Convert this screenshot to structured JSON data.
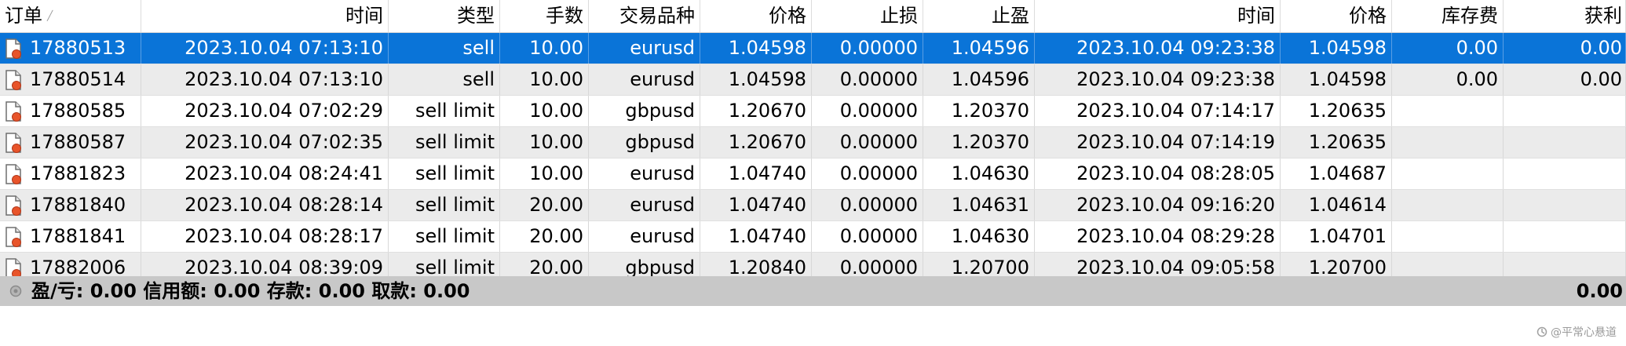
{
  "columns": [
    "订单",
    "时间",
    "类型",
    "手数",
    "交易品种",
    "价格",
    "止损",
    "止盈",
    "时间",
    "价格",
    "库存费",
    "获利"
  ],
  "rows": [
    [
      "17880513",
      "2023.10.04 07:13:10",
      "sell",
      "10.00",
      "eurusd",
      "1.04598",
      "0.00000",
      "1.04596",
      "2023.10.04 09:23:38",
      "1.04598",
      "0.00",
      "0.00"
    ],
    [
      "17880514",
      "2023.10.04 07:13:10",
      "sell",
      "10.00",
      "eurusd",
      "1.04598",
      "0.00000",
      "1.04596",
      "2023.10.04 09:23:38",
      "1.04598",
      "0.00",
      "0.00"
    ],
    [
      "17880585",
      "2023.10.04 07:02:29",
      "sell limit",
      "10.00",
      "gbpusd",
      "1.20670",
      "0.00000",
      "1.20370",
      "2023.10.04 07:14:17",
      "1.20635",
      "",
      ""
    ],
    [
      "17880587",
      "2023.10.04 07:02:35",
      "sell limit",
      "10.00",
      "gbpusd",
      "1.20670",
      "0.00000",
      "1.20370",
      "2023.10.04 07:14:19",
      "1.20635",
      "",
      ""
    ],
    [
      "17881823",
      "2023.10.04 08:24:41",
      "sell limit",
      "10.00",
      "eurusd",
      "1.04740",
      "0.00000",
      "1.04630",
      "2023.10.04 08:28:05",
      "1.04687",
      "",
      ""
    ],
    [
      "17881840",
      "2023.10.04 08:28:14",
      "sell limit",
      "20.00",
      "eurusd",
      "1.04740",
      "0.00000",
      "1.04631",
      "2023.10.04 09:16:20",
      "1.04614",
      "",
      ""
    ],
    [
      "17881841",
      "2023.10.04 08:28:17",
      "sell limit",
      "20.00",
      "eurusd",
      "1.04740",
      "0.00000",
      "1.04630",
      "2023.10.04 08:29:28",
      "1.04701",
      "",
      ""
    ],
    [
      "17882006",
      "2023.10.04 08:39:09",
      "sell limit",
      "20.00",
      "gbpusd",
      "1.20840",
      "0.00000",
      "1.20700",
      "2023.10.04 09:05:58",
      "1.20700",
      "",
      ""
    ]
  ],
  "selected_row": 0,
  "summary": {
    "text": "盈/亏: 0.00  信用额: 0.00  存款: 0.00  取款: 0.00",
    "total": "0.00"
  },
  "watermark": "@平常心悬道",
  "colors": {
    "selected": "#0a74d8",
    "alt_row": "#ebebeb",
    "summary": "#c8c8c8",
    "icon_badge": "#e8542a"
  },
  "icons": {
    "order": "document-icon",
    "summary": "circle-icon"
  }
}
